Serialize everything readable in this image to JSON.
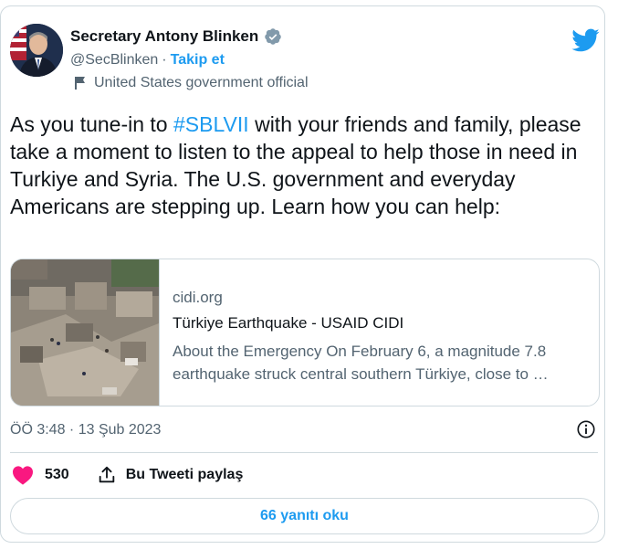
{
  "author": {
    "name": "Secretary Antony Blinken",
    "handle": "@SecBlinken",
    "separator": "·",
    "follow_label": "Takip et",
    "account_label": "United States government official"
  },
  "tweet": {
    "text_before": "As you tune-in to ",
    "hashtag": "#SBLVII",
    "text_after": " with your friends and family, please take a moment to listen to the appeal to help those in need in Turkiye and Syria. The U.S. government and everyday Americans are stepping up. Learn how you can help:"
  },
  "link_card": {
    "domain": "cidi.org",
    "title": "Türkiye Earthquake - USAID CIDI",
    "description": "About the Emergency On February 6, a magnitude 7.8 earthquake struck central southern Türkiye, close to …"
  },
  "timestamp": "ÖÖ 3:48 · 13 Şub 2023",
  "actions": {
    "like_count": "530",
    "share_label": "Bu Tweeti paylaş"
  },
  "reply_button_label": "66 yanıtı oku",
  "colors": {
    "accent": "#1d9bf0",
    "like": "#f91880",
    "secondary_text": "#536471",
    "border": "#cfd9de"
  },
  "icons": [
    "verified-badge-icon",
    "twitter-bird-icon",
    "flag-icon",
    "info-icon",
    "heart-icon",
    "share-icon"
  ]
}
